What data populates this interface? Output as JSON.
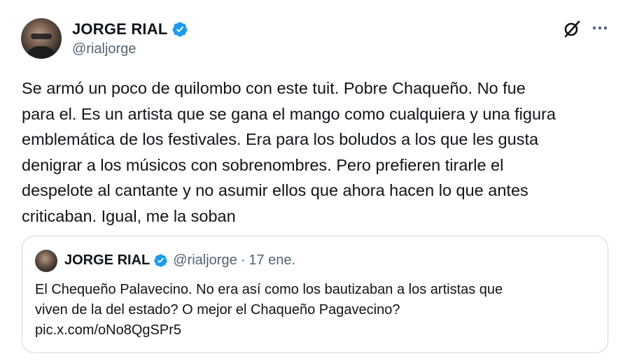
{
  "author": {
    "name": "JORGE RIAL",
    "handle": "@rialjorge",
    "verified": true
  },
  "tweet": {
    "text": "Se armó un poco de quilombo con este tuit. Pobre Chaqueño. No fue\npara el. Es un artista que se gana el mango como cualquiera y una figura\nemblemática de los festivales. Era para los boludos a los que les gusta\ndenigrar a los músicos con sobrenombres. Pero prefieren tirarle el\ndespelote al cantante y no asumir ellos que ahora hacen lo que antes\ncriticaban. Igual, me la soban"
  },
  "quoted": {
    "name": "JORGE RIAL",
    "handle": "@rialjorge",
    "separator": "·",
    "date": "17 ene.",
    "text": "El Chequeño Palavecino. No era así como los bautizaban a los artistas que\nviven de la del estado? O mejor el Chaqueño Pagavecino?\npic.x.com/oNo8QgSPr5"
  },
  "icons": {
    "verified": "verified-badge-icon",
    "grok": "grok-icon",
    "more": "more-options-icon"
  },
  "colors": {
    "verified": "#1d9bf0",
    "secondary_text": "#536471",
    "primary_text": "#0f1419",
    "border": "#cfd9de"
  }
}
